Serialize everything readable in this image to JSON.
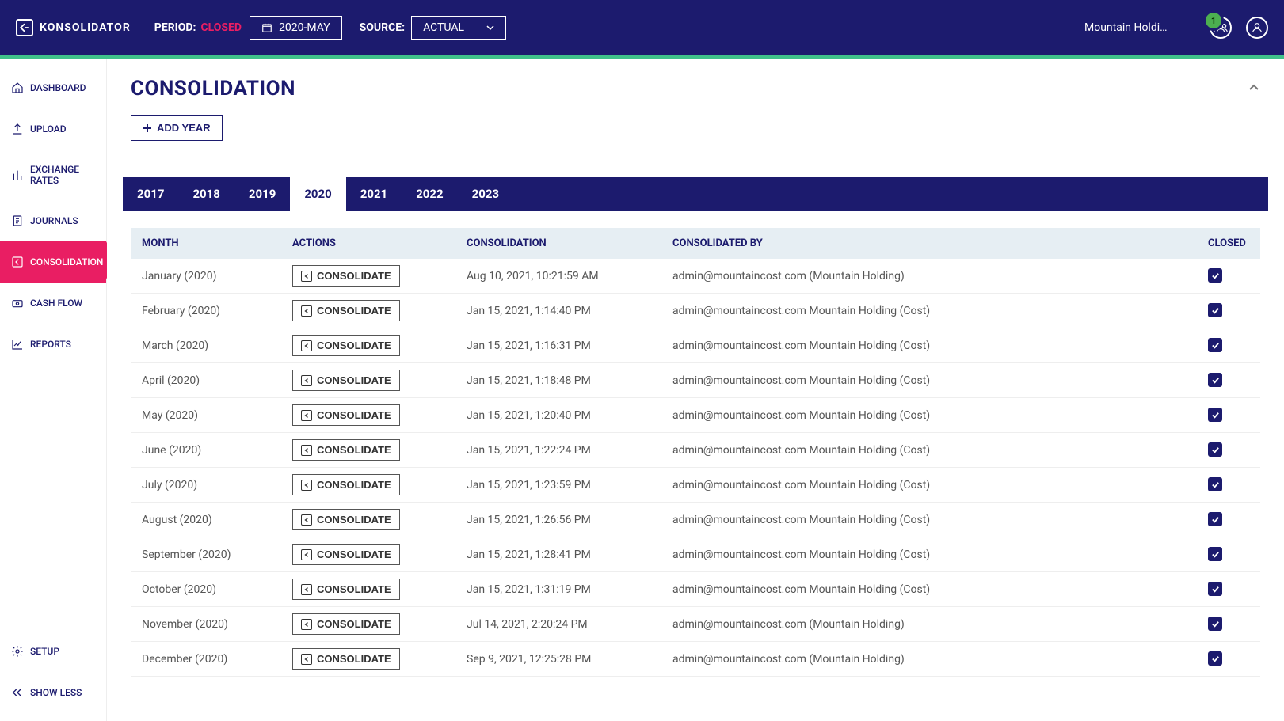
{
  "brand": "KONSOLIDATOR",
  "header": {
    "period_label": "PERIOD:",
    "period_status": "CLOSED",
    "period_value": "2020-MAY",
    "source_label": "SOURCE:",
    "source_value": "ACTUAL",
    "company": "Mountain Holdin...",
    "badge_count": "1"
  },
  "sidebar": {
    "items": [
      {
        "label": "DASHBOARD"
      },
      {
        "label": "UPLOAD"
      },
      {
        "label": "EXCHANGE RATES"
      },
      {
        "label": "JOURNALS"
      },
      {
        "label": "CONSOLIDATION"
      },
      {
        "label": "CASH FLOW"
      },
      {
        "label": "REPORTS"
      }
    ],
    "setup": "SETUP",
    "showless": "SHOW LESS"
  },
  "page": {
    "title": "CONSOLIDATION",
    "add_year": "ADD YEAR"
  },
  "years": [
    "2017",
    "2018",
    "2019",
    "2020",
    "2021",
    "2022",
    "2023"
  ],
  "active_year": "2020",
  "table": {
    "headers": {
      "month": "MONTH",
      "actions": "ACTIONS",
      "consolidation": "CONSOLIDATION",
      "by": "CONSOLIDATED BY",
      "closed": "CLOSED"
    },
    "action_label": "CONSOLIDATE",
    "rows": [
      {
        "month": "January (2020)",
        "consolidation": "Aug 10, 2021, 10:21:59 AM",
        "by": "admin@mountaincost.com (Mountain Holding)",
        "closed": true
      },
      {
        "month": "February (2020)",
        "consolidation": "Jan 15, 2021, 1:14:40 PM",
        "by": "admin@mountaincost.com Mountain Holding (Cost)",
        "closed": true
      },
      {
        "month": "March (2020)",
        "consolidation": "Jan 15, 2021, 1:16:31 PM",
        "by": "admin@mountaincost.com Mountain Holding (Cost)",
        "closed": true
      },
      {
        "month": "April (2020)",
        "consolidation": "Jan 15, 2021, 1:18:48 PM",
        "by": "admin@mountaincost.com Mountain Holding (Cost)",
        "closed": true
      },
      {
        "month": "May (2020)",
        "consolidation": "Jan 15, 2021, 1:20:40 PM",
        "by": "admin@mountaincost.com Mountain Holding (Cost)",
        "closed": true
      },
      {
        "month": "June (2020)",
        "consolidation": "Jan 15, 2021, 1:22:24 PM",
        "by": "admin@mountaincost.com Mountain Holding (Cost)",
        "closed": true
      },
      {
        "month": "July (2020)",
        "consolidation": "Jan 15, 2021, 1:23:59 PM",
        "by": "admin@mountaincost.com Mountain Holding (Cost)",
        "closed": true
      },
      {
        "month": "August (2020)",
        "consolidation": "Jan 15, 2021, 1:26:56 PM",
        "by": "admin@mountaincost.com Mountain Holding (Cost)",
        "closed": true
      },
      {
        "month": "September (2020)",
        "consolidation": "Jan 15, 2021, 1:28:41 PM",
        "by": "admin@mountaincost.com Mountain Holding (Cost)",
        "closed": true
      },
      {
        "month": "October (2020)",
        "consolidation": "Jan 15, 2021, 1:31:19 PM",
        "by": "admin@mountaincost.com Mountain Holding (Cost)",
        "closed": true
      },
      {
        "month": "November (2020)",
        "consolidation": "Jul 14, 2021, 2:20:24 PM",
        "by": "admin@mountaincost.com (Mountain Holding)",
        "closed": true
      },
      {
        "month": "December (2020)",
        "consolidation": "Sep 9, 2021, 12:25:28 PM",
        "by": "admin@mountaincost.com (Mountain Holding)",
        "closed": true
      }
    ]
  }
}
